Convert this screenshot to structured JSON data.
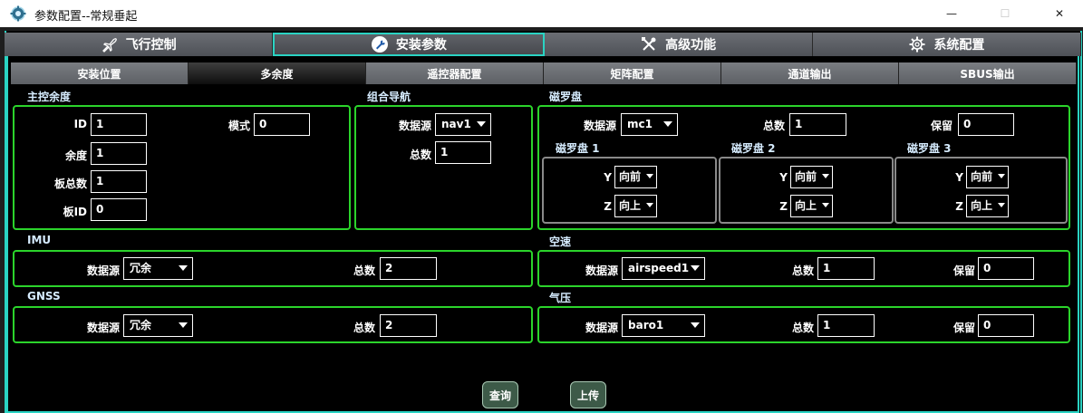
{
  "window": {
    "title": "参数配置--常规垂起",
    "minimize": "—",
    "maximize": "☐",
    "close": "✕"
  },
  "top_tabs": [
    {
      "label": "飞行控制",
      "icon": "airplane-icon",
      "active": false
    },
    {
      "label": "安装参数",
      "icon": "wrench-icon",
      "active": true
    },
    {
      "label": "高级功能",
      "icon": "tools-icon",
      "active": false
    },
    {
      "label": "系统配置",
      "icon": "gear-icon",
      "active": false
    }
  ],
  "sub_tabs": [
    {
      "label": "安装位置",
      "active": false
    },
    {
      "label": "多余度",
      "active": true
    },
    {
      "label": "遥控器配置",
      "active": false
    },
    {
      "label": "矩阵配置",
      "active": false
    },
    {
      "label": "通道输出",
      "active": false
    },
    {
      "label": "SBUS输出",
      "active": false
    }
  ],
  "main_control": {
    "title": "主控余度",
    "id_label": "ID",
    "id_value": "1",
    "mode_label": "模式",
    "mode_value": "0",
    "redundancy_label": "余度",
    "redundancy_value": "1",
    "board_total_label": "板总数",
    "board_total_value": "1",
    "board_id_label": "板ID",
    "board_id_value": "0"
  },
  "integrated_nav": {
    "title": "组合导航",
    "source_label": "数据源",
    "source_value": "nav1",
    "total_label": "总数",
    "total_value": "1"
  },
  "compass": {
    "title": "磁罗盘",
    "source_label": "数据源",
    "source_value": "mc1",
    "total_label": "总数",
    "total_value": "1",
    "reserve_label": "保留",
    "reserve_value": "0",
    "units": [
      {
        "title": "磁罗盘 1",
        "y_label": "Y",
        "y_value": "向前",
        "z_label": "Z",
        "z_value": "向上"
      },
      {
        "title": "磁罗盘 2",
        "y_label": "Y",
        "y_value": "向前",
        "z_label": "Z",
        "z_value": "向上"
      },
      {
        "title": "磁罗盘 3",
        "y_label": "Y",
        "y_value": "向前",
        "z_label": "Z",
        "z_value": "向上"
      }
    ]
  },
  "imu": {
    "title": "IMU",
    "source_label": "数据源",
    "source_value": "冗余",
    "total_label": "总数",
    "total_value": "2"
  },
  "airspeed": {
    "title": "空速",
    "source_label": "数据源",
    "source_value": "airspeed1",
    "total_label": "总数",
    "total_value": "1",
    "reserve_label": "保留",
    "reserve_value": "0"
  },
  "gnss": {
    "title": "GNSS",
    "source_label": "数据源",
    "source_value": "冗余",
    "total_label": "总数",
    "total_value": "2"
  },
  "baro": {
    "title": "气压",
    "source_label": "数据源",
    "source_value": "baro1",
    "total_label": "总数",
    "total_value": "1",
    "reserve_label": "保留",
    "reserve_value": "0"
  },
  "actions": {
    "query_label": "查询",
    "upload_label": "上传"
  },
  "colors": {
    "accent_cyan": "#2ad3c3",
    "panel_green": "#2bd42b",
    "button_green": "#3d5a48"
  }
}
